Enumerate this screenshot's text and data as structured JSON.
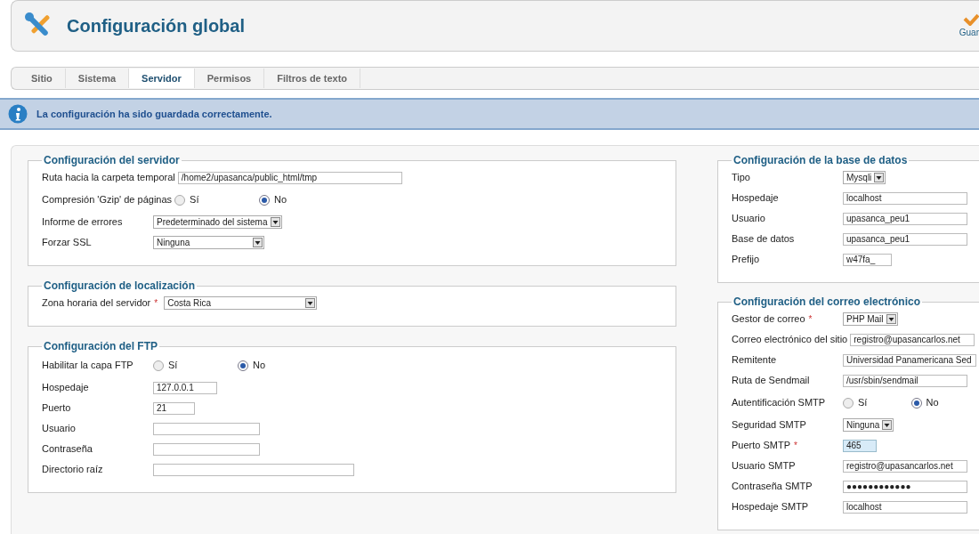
{
  "header": {
    "title": "Configuración global",
    "toolbar": [
      {
        "label": "Guar"
      }
    ]
  },
  "tabs": [
    {
      "label": "Sitio",
      "selected": false
    },
    {
      "label": "Sistema",
      "selected": false
    },
    {
      "label": "Servidor",
      "selected": true
    },
    {
      "label": "Permisos",
      "selected": false
    },
    {
      "label": "Filtros de texto",
      "selected": false
    }
  ],
  "message": "La configuración ha sido guardada correctamente.",
  "left_column": [
    {
      "title": "Configuración del servidor",
      "fields": [
        {
          "kind": "text",
          "label": "Ruta hacia la carpeta temporal",
          "value": "/home2/upasanca/public_html/tmp"
        },
        {
          "kind": "radio",
          "label": "Compresión 'Gzip' de páginas",
          "options": [
            {
              "label": "Sí",
              "selected": false
            },
            {
              "label": "No",
              "selected": true
            }
          ]
        },
        {
          "kind": "select",
          "label": "Informe de errores",
          "value": "Predeterminado del sistema"
        },
        {
          "kind": "select",
          "label": "Forzar SSL",
          "value": "Ninguna"
        }
      ]
    },
    {
      "title": "Configuración de localización",
      "fields": [
        {
          "kind": "select",
          "label": "Zona horaria del servidor",
          "marker": "*",
          "value": "Costa Rica"
        }
      ]
    },
    {
      "title": "Configuración del FTP",
      "fields": [
        {
          "kind": "radio",
          "label": "Habilitar la capa FTP",
          "options": [
            {
              "label": "Sí",
              "selected": false
            },
            {
              "label": "No",
              "selected": true
            }
          ]
        },
        {
          "kind": "text",
          "label": "Hospedaje",
          "value": "127.0.0.1"
        },
        {
          "kind": "text",
          "label": "Puerto",
          "value": "21"
        },
        {
          "kind": "text",
          "label": "Usuario"
        },
        {
          "kind": "text",
          "label": "Contraseña"
        },
        {
          "kind": "text",
          "label": "Directorio raíz"
        }
      ]
    }
  ],
  "right_column": [
    {
      "title": "Configuración de la base de datos",
      "fields": [
        {
          "kind": "select",
          "label": "Tipo",
          "value": "Mysqli"
        },
        {
          "kind": "text",
          "label": "Hospedaje",
          "value": "localhost"
        },
        {
          "kind": "text",
          "label": "Usuario",
          "value": "upasanca_peu1"
        },
        {
          "kind": "text",
          "label": "Base de datos",
          "value": "upasanca_peu1"
        },
        {
          "kind": "text",
          "label": "Prefijo",
          "value": "w47fa_"
        }
      ]
    },
    {
      "title": "Configuración del correo electrónico",
      "fields": [
        {
          "kind": "select",
          "label": "Gestor de correo",
          "marker": "*",
          "value": "PHP Mail"
        },
        {
          "kind": "text",
          "label": "Correo electrónico del sitio",
          "value": "registro@upasancarlos.net"
        },
        {
          "kind": "text",
          "label": "Remitente",
          "value": "Universidad Panamericana Sed"
        },
        {
          "kind": "text",
          "label": "Ruta de Sendmail",
          "value": "/usr/sbin/sendmail"
        },
        {
          "kind": "radio",
          "label": "Autentificación SMTP",
          "options": [
            {
              "label": "Sí",
              "selected": false
            },
            {
              "label": "No",
              "selected": true
            }
          ]
        },
        {
          "kind": "select",
          "label": "Seguridad SMTP",
          "value": "Ninguna"
        },
        {
          "kind": "text",
          "label": "Puerto SMTP",
          "marker": "*",
          "value": "465",
          "focused": true
        },
        {
          "kind": "text",
          "label": "Usuario SMTP",
          "value": "registro@upasancarlos.net"
        },
        {
          "kind": "text",
          "label": "Contraseña SMTP",
          "value": "●●●●●●●●●●●●"
        },
        {
          "kind": "text",
          "label": "Hospedaje SMTP",
          "value": "localhost"
        }
      ]
    }
  ]
}
